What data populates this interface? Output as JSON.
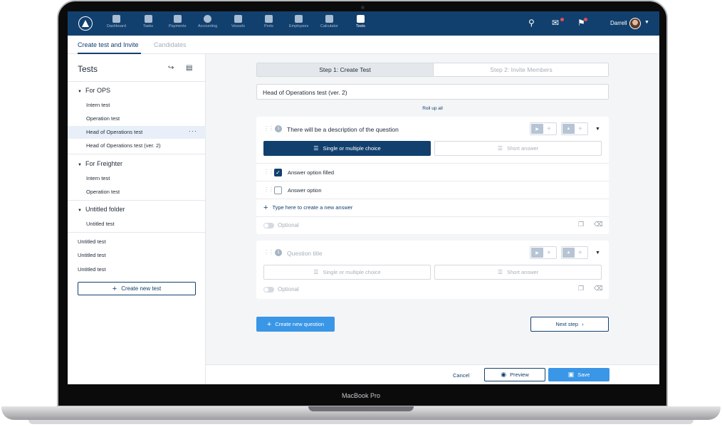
{
  "device": {
    "brand_label": "MacBook Pro"
  },
  "nav": {
    "items": [
      {
        "label": "Dashboard",
        "icon": "dashboard-icon"
      },
      {
        "label": "Tasks",
        "icon": "tasks-icon"
      },
      {
        "label": "Payments",
        "icon": "payments-icon"
      },
      {
        "label": "Accounting",
        "icon": "accounting-icon"
      },
      {
        "label": "Vessels",
        "icon": "vessels-icon"
      },
      {
        "label": "Ports",
        "icon": "anchor-icon"
      },
      {
        "label": "Employees",
        "icon": "employees-icon"
      },
      {
        "label": "Calculator",
        "icon": "calculator-icon"
      },
      {
        "label": "Tests",
        "icon": "tests-icon"
      }
    ],
    "active_item": "Tests",
    "user_name": "Darrell",
    "brand_color": "#12406e"
  },
  "tabs": [
    "Create test and Invite",
    "Candidates"
  ],
  "sidebar": {
    "title": "Tests",
    "folders": [
      {
        "name": "For OPS",
        "tests": [
          "Intern test",
          "Operation test",
          "Head of Operations test",
          "Head of Operations test (ver. 2)"
        ]
      },
      {
        "name": "For Freighter",
        "tests": [
          "Intern test",
          "Operation test"
        ]
      },
      {
        "name": "Untitled folder",
        "tests": [
          "Untitled test"
        ]
      }
    ],
    "loose_tests": [
      "Untitled test",
      "Untitled test",
      "Untitled test"
    ],
    "selected_test": "Head of Operations test",
    "more_label": "···",
    "create_button": "Create new test"
  },
  "steps": [
    "Step 1: Create Test",
    "Step 2: Invite Members"
  ],
  "test_name": "Head of Operations test (ver. 2)",
  "roll_up_label": "Roll up all",
  "questions": [
    {
      "number": "1",
      "title": "There will be a description of the question",
      "types": [
        "Single or multiple choice",
        "Short answer"
      ],
      "selected_type": "Single or multiple choice",
      "answers": [
        {
          "label": "Answer option filled",
          "checked": true
        },
        {
          "label": "Answer option",
          "checked": false
        }
      ],
      "new_answer_label": "Type here to create a new answer",
      "optional_label": "Optional"
    },
    {
      "number": "1",
      "title": "Question title",
      "types": [
        "Single or multiple choice",
        "Short answer"
      ],
      "selected_type": "",
      "optional_label": "Optional"
    }
  ],
  "actions": {
    "create_question": "Create new question",
    "next_step": "Next step",
    "cancel": "Cancel",
    "preview": "Preview",
    "save": "Save"
  },
  "colors": {
    "accent": "#3a96e6",
    "navy": "#12406e",
    "muted": "#a6b0bb"
  }
}
